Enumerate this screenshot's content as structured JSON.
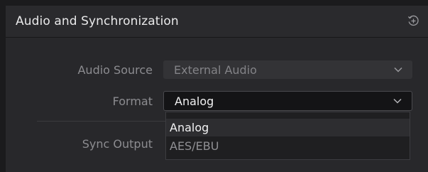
{
  "panel": {
    "title": "Audio and Synchronization",
    "reset_icon": "reset-plus-circle-icon"
  },
  "audio_source": {
    "label": "Audio Source",
    "value": "External Audio"
  },
  "format": {
    "label": "Format",
    "value": "Analog",
    "options": [
      "Analog",
      "AES/EBU"
    ],
    "selected_index": 0
  },
  "sync_output": {
    "label": "Sync Output"
  },
  "colors": {
    "background": "#28282b",
    "header": "#2a2a2d",
    "label_text": "#8c8c90",
    "active_text": "#f0f0f1"
  }
}
